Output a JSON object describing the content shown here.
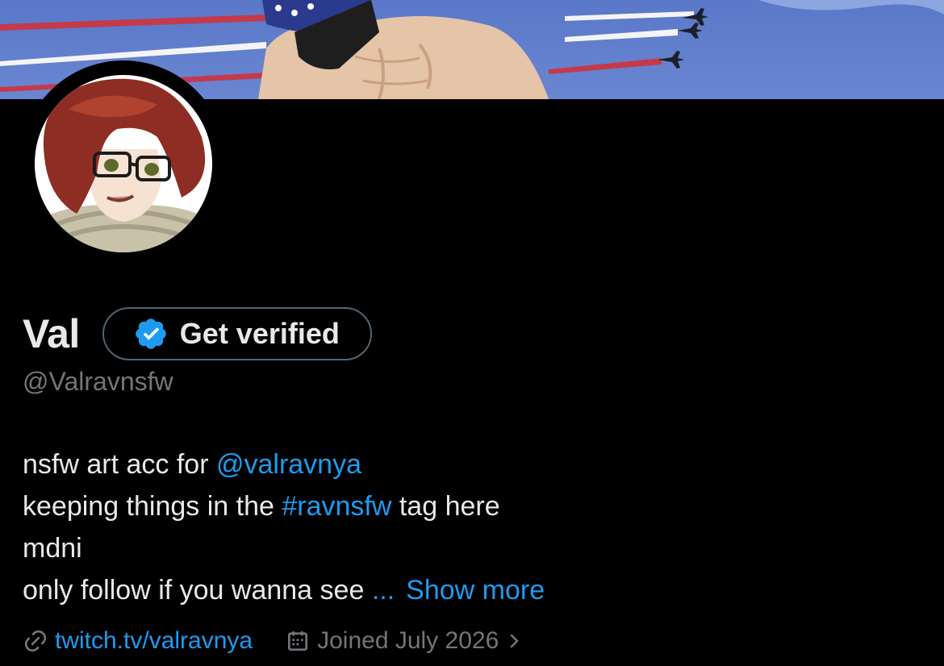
{
  "profile": {
    "display_name": "Val",
    "handle": "@Valravnsfw",
    "get_verified_label": "Get verified"
  },
  "bio": {
    "line1_prefix": "nsfw art acc for ",
    "line1_mention": "@valravnya",
    "line2_prefix": "keeping things in the ",
    "line2_hashtag": "#ravnsfw",
    "line2_suffix": " tag here",
    "line3": "mdni",
    "line4_text": "only follow if you wanna see ",
    "line4_ellipsis": "...",
    "show_more": "Show more"
  },
  "meta": {
    "website": "twitch.tv/valravnya",
    "joined": "Joined July 2026"
  },
  "icons": {
    "verified_badge": "verified-badge-icon",
    "link": "link-icon",
    "calendar": "calendar-icon",
    "chevron": "chevron-right-icon"
  },
  "colors": {
    "background": "#000000",
    "text": "#e7e9ea",
    "muted": "#71767b",
    "accent": "#1d9bf0",
    "button_border": "#536471"
  }
}
